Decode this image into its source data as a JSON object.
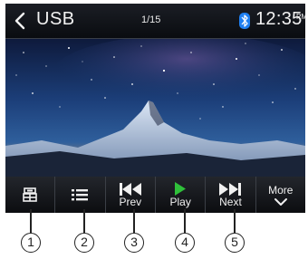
{
  "status_bar": {
    "source": "USB",
    "track_counter": "1/15",
    "time": "12:35",
    "ampm": "PM"
  },
  "controls": [
    {
      "id": "source-menu",
      "label": "",
      "icon": "source-menu-icon"
    },
    {
      "id": "list",
      "label": "",
      "icon": "list-icon"
    },
    {
      "id": "prev",
      "label": "Prev",
      "icon": "skip-previous-icon"
    },
    {
      "id": "play",
      "label": "Play",
      "icon": "play-icon"
    },
    {
      "id": "next",
      "label": "Next",
      "icon": "skip-next-icon"
    },
    {
      "id": "more",
      "label": "More",
      "icon": "chevron-down-icon"
    }
  ],
  "callouts": [
    "1",
    "2",
    "3",
    "4",
    "5"
  ],
  "colors": {
    "play_accent": "#2fc03a",
    "bluetooth": "#1f7ff0"
  }
}
